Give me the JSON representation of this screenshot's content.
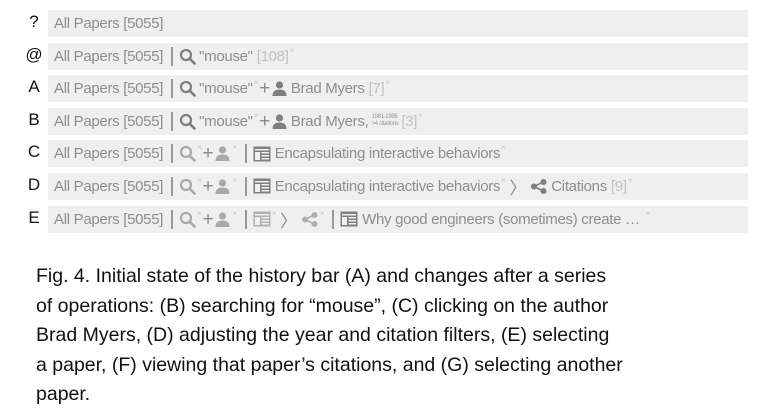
{
  "row_labels": [
    "?",
    "@",
    "A",
    "B",
    "C",
    "D",
    "E"
  ],
  "bar": {
    "all_papers": "All Papers [5055]",
    "search_query": "\"mouse\"",
    "search_count": "[108]",
    "author": "Brad Myers",
    "author_comma": "Brad Myers,",
    "author_count_a": "[7]",
    "year_filter": "1981-1996",
    "citation_filter": ">4 citations",
    "author_count_b": "[3]",
    "paper_1": "Encapsulating interactive behaviors",
    "citations": "Citations",
    "citations_count": "[9]",
    "paper_2": "Why good engineers (sometimes) create …",
    "close_glyph": "×",
    "plus_glyph": "+",
    "chevron_glyph": "〉"
  },
  "caption_lines": [
    "Fig. 4. Initial state of the history bar (A) and changes after a series",
    "of operations: (B) searching for “mouse”, (C) clicking on the author",
    "Brad Myers, (D) adjusting the year and citation filters, (E) selecting",
    "a paper, (F) viewing that paper’s citations, and (G) selecting another",
    "paper."
  ],
  "colors": {
    "bar_background": "#efefef",
    "bar_text": "#8e8e8e",
    "caption_text": "#111111"
  }
}
